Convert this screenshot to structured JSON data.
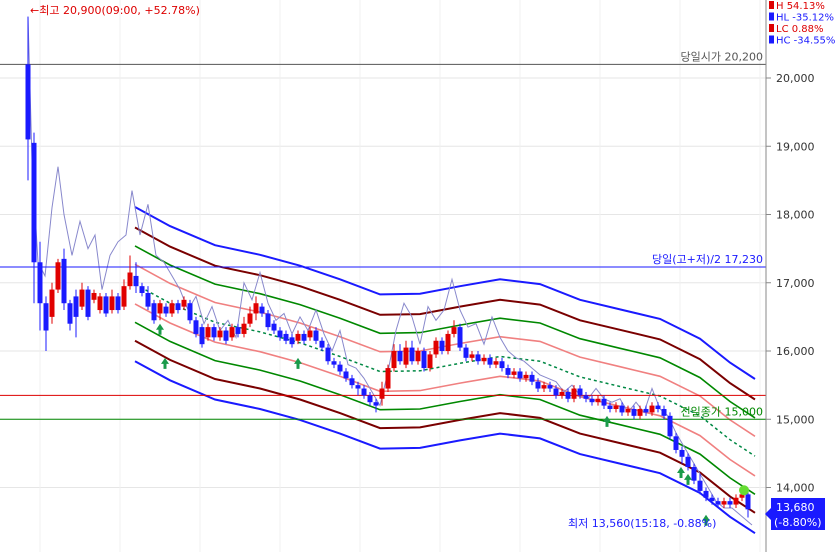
{
  "chart_data": {
    "type": "candlestick",
    "y_axis": {
      "ticks": [
        "14,000",
        "15,000",
        "16,000",
        "17,000",
        "18,000",
        "19,000",
        "20,000"
      ],
      "values": [
        14000,
        15000,
        16000,
        17000,
        18000,
        19000,
        20000
      ],
      "ylim": [
        13120,
        20990
      ]
    },
    "high_label": "←최고 20,900(09:00, +52.78%)",
    "low_label": "최저 13,560(15:18, -0.88%)",
    "ref_lines": [
      {
        "label": "당일시가 20,200",
        "value": 20200,
        "color": "#555555"
      },
      {
        "label": "당일(고+저)/2 17,230",
        "value": 17230,
        "color": "#1a1aff"
      },
      {
        "label": "전일종가 15,000",
        "value": 15000,
        "color": "#008800"
      },
      {
        "value": 15350,
        "color": "#dd0000"
      }
    ],
    "corner_stats": [
      {
        "text": "H 54.13%",
        "color": "#dd0000"
      },
      {
        "text": "HL -35.12%",
        "color": "#1a1aff"
      },
      {
        "text": "LC 0.88%",
        "color": "#dd0000"
      },
      {
        "text": "HC -34.55%",
        "color": "#1a1aff"
      }
    ],
    "current_price": {
      "price": "13,680",
      "change": "(-8.80%)",
      "value": 13680
    },
    "colors": {
      "up": "#e00000",
      "down": "#1a1aff",
      "band_outer": "#1a1aff",
      "band_2": "#7a0000",
      "band_3": "#008800",
      "band_4": "#f08080",
      "mid": "#008844",
      "line": "#8888cc"
    }
  }
}
